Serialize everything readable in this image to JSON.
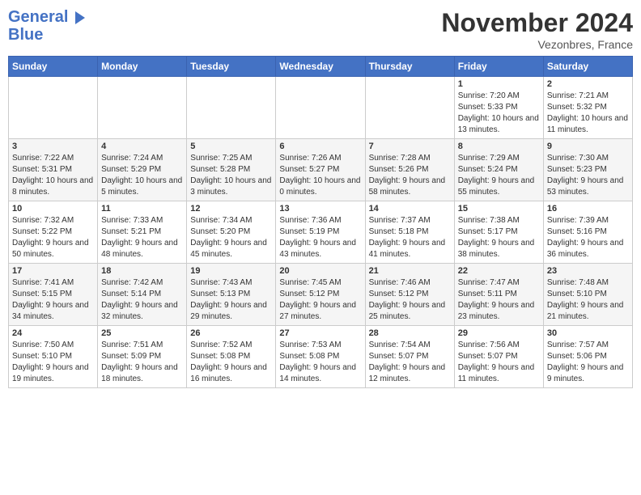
{
  "header": {
    "logo_line1": "General",
    "logo_line2": "Blue",
    "month": "November 2024",
    "location": "Vezonbres, France"
  },
  "weekdays": [
    "Sunday",
    "Monday",
    "Tuesday",
    "Wednesday",
    "Thursday",
    "Friday",
    "Saturday"
  ],
  "weeks": [
    [
      {
        "day": "",
        "info": ""
      },
      {
        "day": "",
        "info": ""
      },
      {
        "day": "",
        "info": ""
      },
      {
        "day": "",
        "info": ""
      },
      {
        "day": "",
        "info": ""
      },
      {
        "day": "1",
        "info": "Sunrise: 7:20 AM\nSunset: 5:33 PM\nDaylight: 10 hours and 13 minutes."
      },
      {
        "day": "2",
        "info": "Sunrise: 7:21 AM\nSunset: 5:32 PM\nDaylight: 10 hours and 11 minutes."
      }
    ],
    [
      {
        "day": "3",
        "info": "Sunrise: 7:22 AM\nSunset: 5:31 PM\nDaylight: 10 hours and 8 minutes."
      },
      {
        "day": "4",
        "info": "Sunrise: 7:24 AM\nSunset: 5:29 PM\nDaylight: 10 hours and 5 minutes."
      },
      {
        "day": "5",
        "info": "Sunrise: 7:25 AM\nSunset: 5:28 PM\nDaylight: 10 hours and 3 minutes."
      },
      {
        "day": "6",
        "info": "Sunrise: 7:26 AM\nSunset: 5:27 PM\nDaylight: 10 hours and 0 minutes."
      },
      {
        "day": "7",
        "info": "Sunrise: 7:28 AM\nSunset: 5:26 PM\nDaylight: 9 hours and 58 minutes."
      },
      {
        "day": "8",
        "info": "Sunrise: 7:29 AM\nSunset: 5:24 PM\nDaylight: 9 hours and 55 minutes."
      },
      {
        "day": "9",
        "info": "Sunrise: 7:30 AM\nSunset: 5:23 PM\nDaylight: 9 hours and 53 minutes."
      }
    ],
    [
      {
        "day": "10",
        "info": "Sunrise: 7:32 AM\nSunset: 5:22 PM\nDaylight: 9 hours and 50 minutes."
      },
      {
        "day": "11",
        "info": "Sunrise: 7:33 AM\nSunset: 5:21 PM\nDaylight: 9 hours and 48 minutes."
      },
      {
        "day": "12",
        "info": "Sunrise: 7:34 AM\nSunset: 5:20 PM\nDaylight: 9 hours and 45 minutes."
      },
      {
        "day": "13",
        "info": "Sunrise: 7:36 AM\nSunset: 5:19 PM\nDaylight: 9 hours and 43 minutes."
      },
      {
        "day": "14",
        "info": "Sunrise: 7:37 AM\nSunset: 5:18 PM\nDaylight: 9 hours and 41 minutes."
      },
      {
        "day": "15",
        "info": "Sunrise: 7:38 AM\nSunset: 5:17 PM\nDaylight: 9 hours and 38 minutes."
      },
      {
        "day": "16",
        "info": "Sunrise: 7:39 AM\nSunset: 5:16 PM\nDaylight: 9 hours and 36 minutes."
      }
    ],
    [
      {
        "day": "17",
        "info": "Sunrise: 7:41 AM\nSunset: 5:15 PM\nDaylight: 9 hours and 34 minutes."
      },
      {
        "day": "18",
        "info": "Sunrise: 7:42 AM\nSunset: 5:14 PM\nDaylight: 9 hours and 32 minutes."
      },
      {
        "day": "19",
        "info": "Sunrise: 7:43 AM\nSunset: 5:13 PM\nDaylight: 9 hours and 29 minutes."
      },
      {
        "day": "20",
        "info": "Sunrise: 7:45 AM\nSunset: 5:12 PM\nDaylight: 9 hours and 27 minutes."
      },
      {
        "day": "21",
        "info": "Sunrise: 7:46 AM\nSunset: 5:12 PM\nDaylight: 9 hours and 25 minutes."
      },
      {
        "day": "22",
        "info": "Sunrise: 7:47 AM\nSunset: 5:11 PM\nDaylight: 9 hours and 23 minutes."
      },
      {
        "day": "23",
        "info": "Sunrise: 7:48 AM\nSunset: 5:10 PM\nDaylight: 9 hours and 21 minutes."
      }
    ],
    [
      {
        "day": "24",
        "info": "Sunrise: 7:50 AM\nSunset: 5:10 PM\nDaylight: 9 hours and 19 minutes."
      },
      {
        "day": "25",
        "info": "Sunrise: 7:51 AM\nSunset: 5:09 PM\nDaylight: 9 hours and 18 minutes."
      },
      {
        "day": "26",
        "info": "Sunrise: 7:52 AM\nSunset: 5:08 PM\nDaylight: 9 hours and 16 minutes."
      },
      {
        "day": "27",
        "info": "Sunrise: 7:53 AM\nSunset: 5:08 PM\nDaylight: 9 hours and 14 minutes."
      },
      {
        "day": "28",
        "info": "Sunrise: 7:54 AM\nSunset: 5:07 PM\nDaylight: 9 hours and 12 minutes."
      },
      {
        "day": "29",
        "info": "Sunrise: 7:56 AM\nSunset: 5:07 PM\nDaylight: 9 hours and 11 minutes."
      },
      {
        "day": "30",
        "info": "Sunrise: 7:57 AM\nSunset: 5:06 PM\nDaylight: 9 hours and 9 minutes."
      }
    ]
  ]
}
